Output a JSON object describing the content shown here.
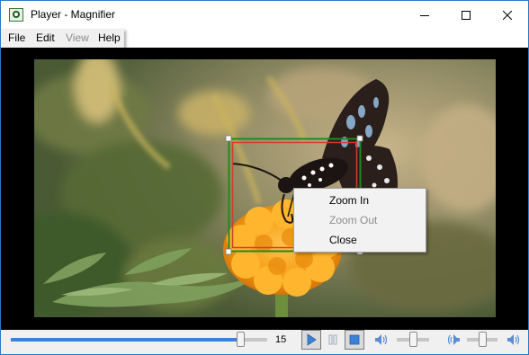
{
  "window": {
    "title": "Player - Magnifier"
  },
  "menu": {
    "file": "File",
    "edit": "Edit",
    "view": "View",
    "help": "Help"
  },
  "context_menu": {
    "zoom_in": "Zoom In",
    "zoom_out": "Zoom Out",
    "close": "Close"
  },
  "controls": {
    "position_value": "15",
    "position_fraction": 0.91,
    "volume_fraction": 0.5,
    "balance_fraction": 0.5
  },
  "colors": {
    "accent": "#3b82d6",
    "magnifier_outer": "#1e8a1e",
    "magnifier_inner": "#d43c2a"
  }
}
